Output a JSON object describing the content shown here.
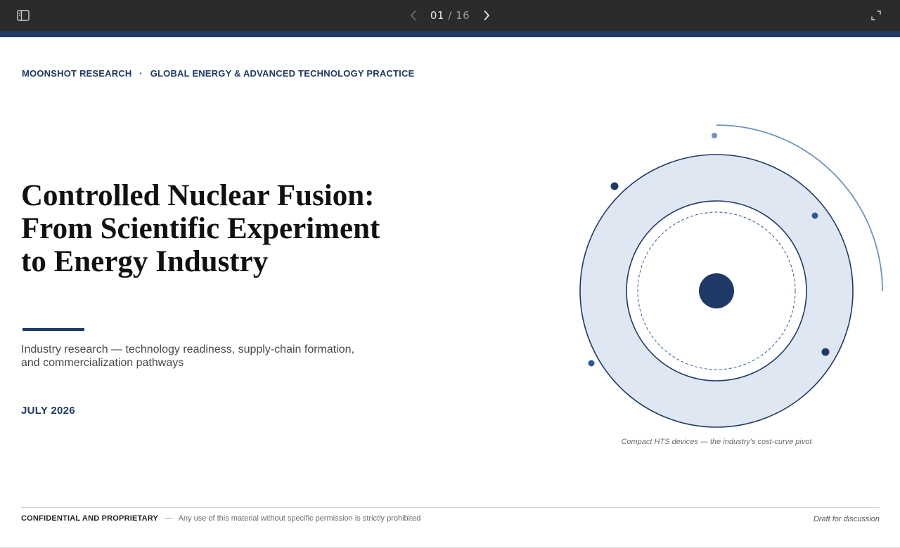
{
  "viewer": {
    "icons": {
      "sidebar": "sidebar-toggle-icon",
      "prev": "chevron-left-icon",
      "next": "chevron-right-icon",
      "fullscreen": "fullscreen-icon"
    },
    "page_current": "01",
    "page_separator": "/",
    "page_total": "16"
  },
  "slide": {
    "eyebrow": {
      "org": "MOONSHOT RESEARCH",
      "dot": "·",
      "practice": "GLOBAL ENERGY & ADVANCED TECHNOLOGY PRACTICE"
    },
    "title_lines": [
      "Controlled Nuclear Fusion:",
      "From Scientific Experiment",
      "to Energy Industry"
    ],
    "subtitle_lines": [
      "Industry research — technology readiness, supply-chain formation,",
      "and commercialization pathways"
    ],
    "date": "JULY 2026",
    "figure_caption": "Compact HTS devices — the industry's cost-curve pivot",
    "footer": {
      "confidential": "CONFIDENTIAL AND PROPRIETARY",
      "dash": "—",
      "notice": "Any use of this material without specific permission is strictly prohibited",
      "draft": "Draft for discussion"
    }
  },
  "colors": {
    "toolbar_bg": "#2b2b2b",
    "accent_navy": "#1f3a66",
    "ring_fill": "#dfe7f2",
    "arc_blue": "#6f93bd",
    "text_dark": "#111111"
  }
}
